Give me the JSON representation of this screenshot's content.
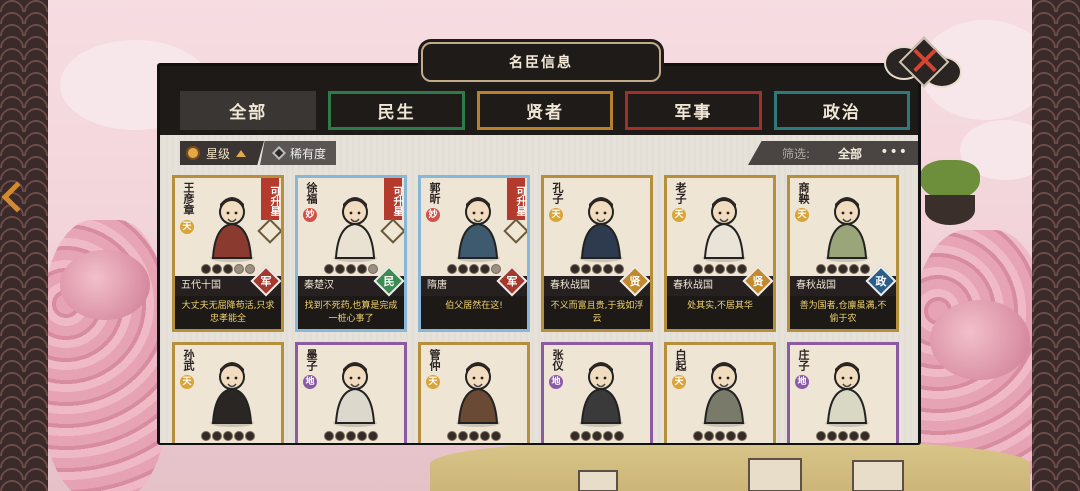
{
  "title": "名臣信息",
  "tabs": [
    {
      "label": "全部",
      "style": "active"
    },
    {
      "label": "民生",
      "style": "t-people"
    },
    {
      "label": "贤者",
      "style": "t-sage"
    },
    {
      "label": "军事",
      "style": "t-mil"
    },
    {
      "label": "政治",
      "style": "t-pol"
    }
  ],
  "sort": {
    "primary_label": "星级",
    "secondary_label": "稀有度"
  },
  "filter": {
    "label": "筛选:",
    "value": "全部",
    "more": "•••"
  },
  "cards": [
    {
      "name": "王彦章",
      "grade": "天",
      "grade_style": "heaven",
      "border": "dark",
      "upgrade": "可升星",
      "stars_filled": 3,
      "stars_total": 5,
      "era": "五代十国",
      "type": "军",
      "type_style": "mil",
      "quote": "大丈夫无屈降苟活,只求忠孝能全",
      "robe": "#8a3a2e"
    },
    {
      "name": "徐福",
      "grade": "妙",
      "grade_style": "wonder",
      "border": "blue",
      "upgrade": "可升星",
      "stars_filled": 4,
      "stars_total": 5,
      "era": "秦楚汉",
      "type": "民",
      "type_style": "people",
      "quote": "找到不死药,也算是完成一桩心事了",
      "robe": "#e9e2d2"
    },
    {
      "name": "郭昕",
      "grade": "妙",
      "grade_style": "wonder",
      "border": "blue",
      "upgrade": "可升星",
      "stars_filled": 4,
      "stars_total": 5,
      "era": "隋唐",
      "type": "军",
      "type_style": "mil",
      "quote": "伯父居然在这!",
      "robe": "#3e5a6e"
    },
    {
      "name": "孔子",
      "grade": "天",
      "grade_style": "heaven",
      "border": "dark",
      "upgrade": "",
      "stars_filled": 5,
      "stars_total": 5,
      "era": "春秋战国",
      "type": "贤",
      "type_style": "sage",
      "quote": "不义而富且贵,于我如浮云",
      "robe": "#2e3a4e"
    },
    {
      "name": "老子",
      "grade": "天",
      "grade_style": "heaven",
      "border": "dark",
      "upgrade": "",
      "stars_filled": 5,
      "stars_total": 5,
      "era": "春秋战国",
      "type": "贤",
      "type_style": "sage",
      "quote": "处其实,不居其华",
      "robe": "#eae4d8"
    },
    {
      "name": "商鞅",
      "grade": "天",
      "grade_style": "heaven",
      "border": "dark",
      "upgrade": "",
      "stars_filled": 5,
      "stars_total": 5,
      "era": "春秋战国",
      "type": "政",
      "type_style": "pol",
      "quote": "善为国者,仓廪虽满,不偷于农",
      "robe": "#9aa67a"
    },
    {
      "name": "孙武",
      "grade": "天",
      "grade_style": "heaven",
      "border": "dark",
      "upgrade": "",
      "stars_filled": 5,
      "stars_total": 5,
      "era": "",
      "type": "",
      "type_style": "",
      "quote": "",
      "robe": "#2a2624"
    },
    {
      "name": "墨子",
      "grade": "地",
      "grade_style": "earth",
      "border": "purple",
      "upgrade": "",
      "stars_filled": 5,
      "stars_total": 5,
      "era": "",
      "type": "",
      "type_style": "",
      "quote": "",
      "robe": "#ddd8cc"
    },
    {
      "name": "管仲",
      "grade": "天",
      "grade_style": "heaven",
      "border": "dark",
      "upgrade": "",
      "stars_filled": 5,
      "stars_total": 5,
      "era": "",
      "type": "",
      "type_style": "",
      "quote": "",
      "robe": "#6a4a34"
    },
    {
      "name": "张仪",
      "grade": "地",
      "grade_style": "earth",
      "border": "purple",
      "upgrade": "",
      "stars_filled": 5,
      "stars_total": 5,
      "era": "",
      "type": "",
      "type_style": "",
      "quote": "",
      "robe": "#3a3a3a"
    },
    {
      "name": "白起",
      "grade": "天",
      "grade_style": "heaven",
      "border": "dark",
      "upgrade": "",
      "stars_filled": 5,
      "stars_total": 5,
      "era": "",
      "type": "",
      "type_style": "",
      "quote": "",
      "robe": "#7a7a6a"
    },
    {
      "name": "庄子",
      "grade": "地",
      "grade_style": "earth",
      "border": "purple",
      "upgrade": "",
      "stars_filled": 5,
      "stars_total": 5,
      "era": "",
      "type": "",
      "type_style": "",
      "quote": "",
      "robe": "#d8d8c4"
    }
  ]
}
